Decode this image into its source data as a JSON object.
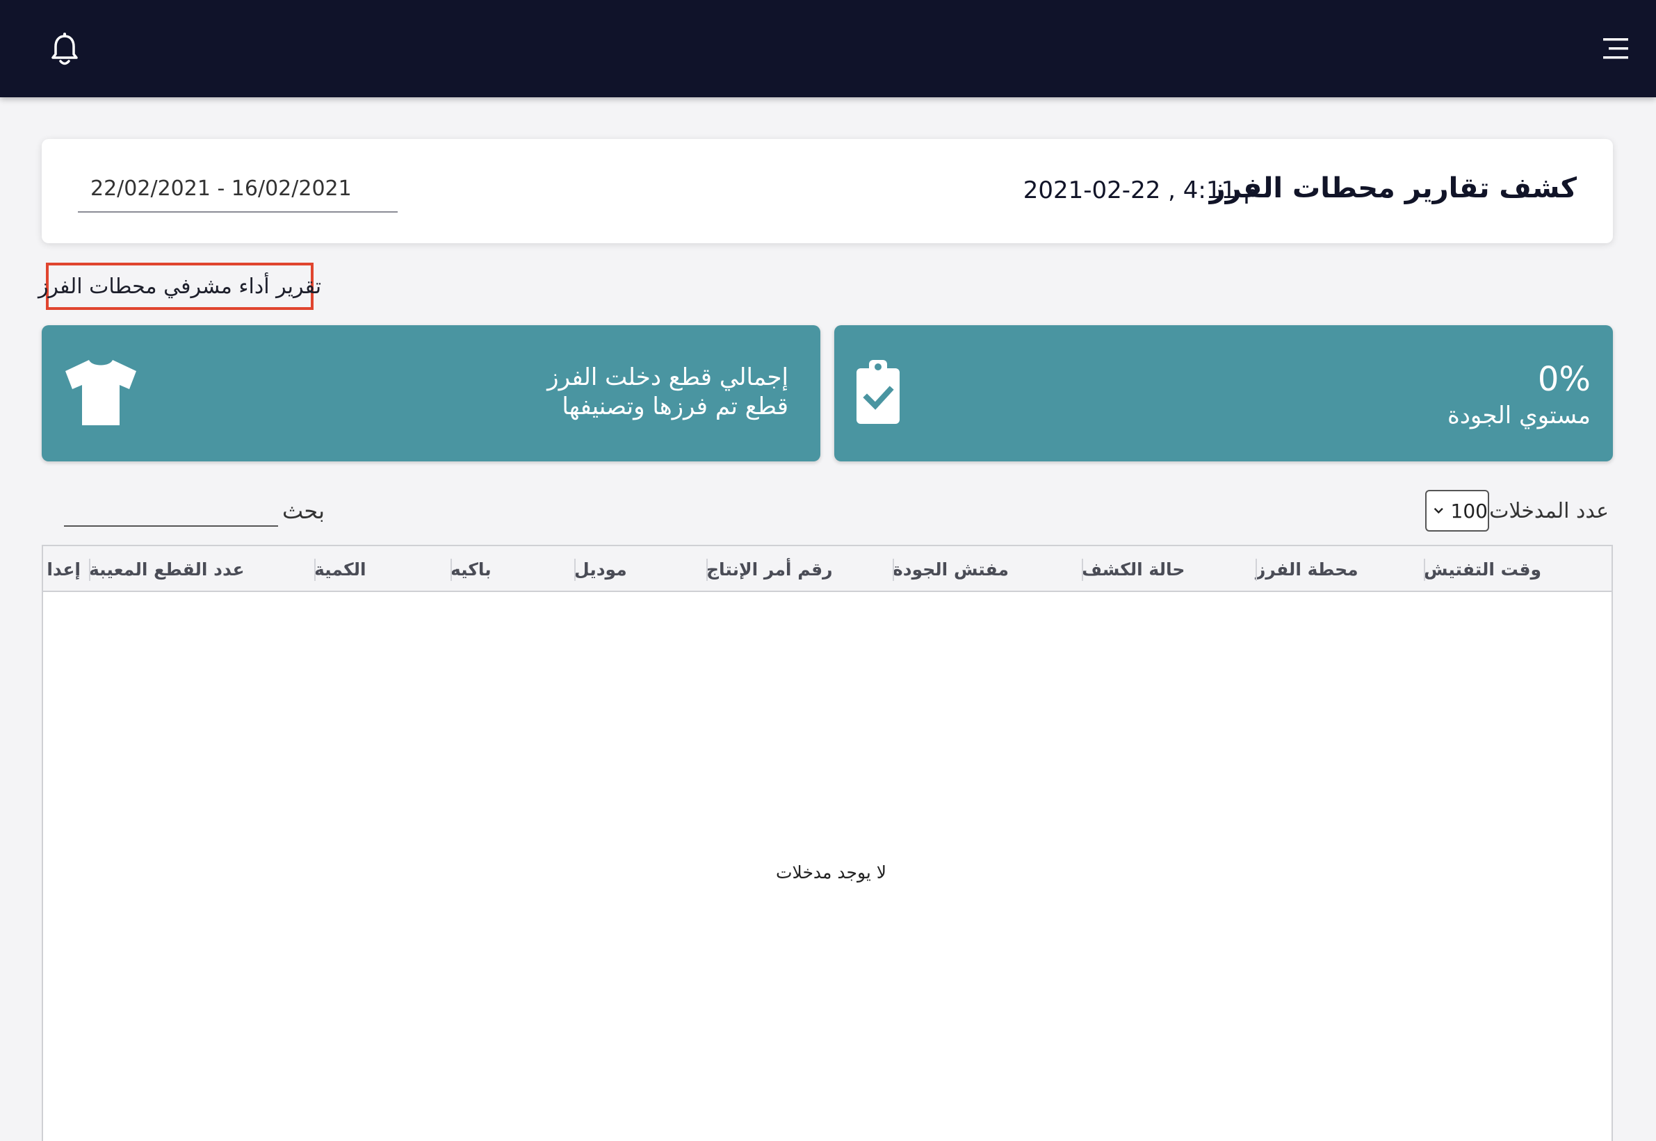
{
  "header": {
    "title": "كشف تقارير محطات الفرز",
    "datetime": "2021-02-22 , 4:11 م",
    "date_range": "22/02/2021  -  16/02/2021"
  },
  "section_link": "تقرير أداء مشرفي محطات الفرز",
  "cards": {
    "quality": {
      "value": "0%",
      "label": "مستوي الجودة"
    },
    "pieces": {
      "line1": "إجمالي قطع دخلت الفرز",
      "line2": "قطع تم فرزها وتصنيفها"
    }
  },
  "controls": {
    "entries_label": "عدد المدخلات",
    "entries_value": "100",
    "search_label": "بحث",
    "search_value": ""
  },
  "table": {
    "columns": [
      "وقت التفتيش",
      "محطة الفرز",
      "حالة الكشف",
      "مفتش الجودة",
      "رقم أمر الإنتاج",
      "موديل",
      "باكيه",
      "الكمية",
      "عدد القطع المعيبة",
      "إعدا"
    ],
    "empty_message": "لا يوجد مدخلات"
  },
  "colors": {
    "topbar": "#10132a",
    "card": "#4a95a1",
    "highlight": "#e0452f"
  },
  "icons": {
    "menu": "hamburger-menu-icon",
    "bell": "bell-icon",
    "clipboard": "clipboard-check-icon",
    "shirt": "t-shirt-icon"
  }
}
